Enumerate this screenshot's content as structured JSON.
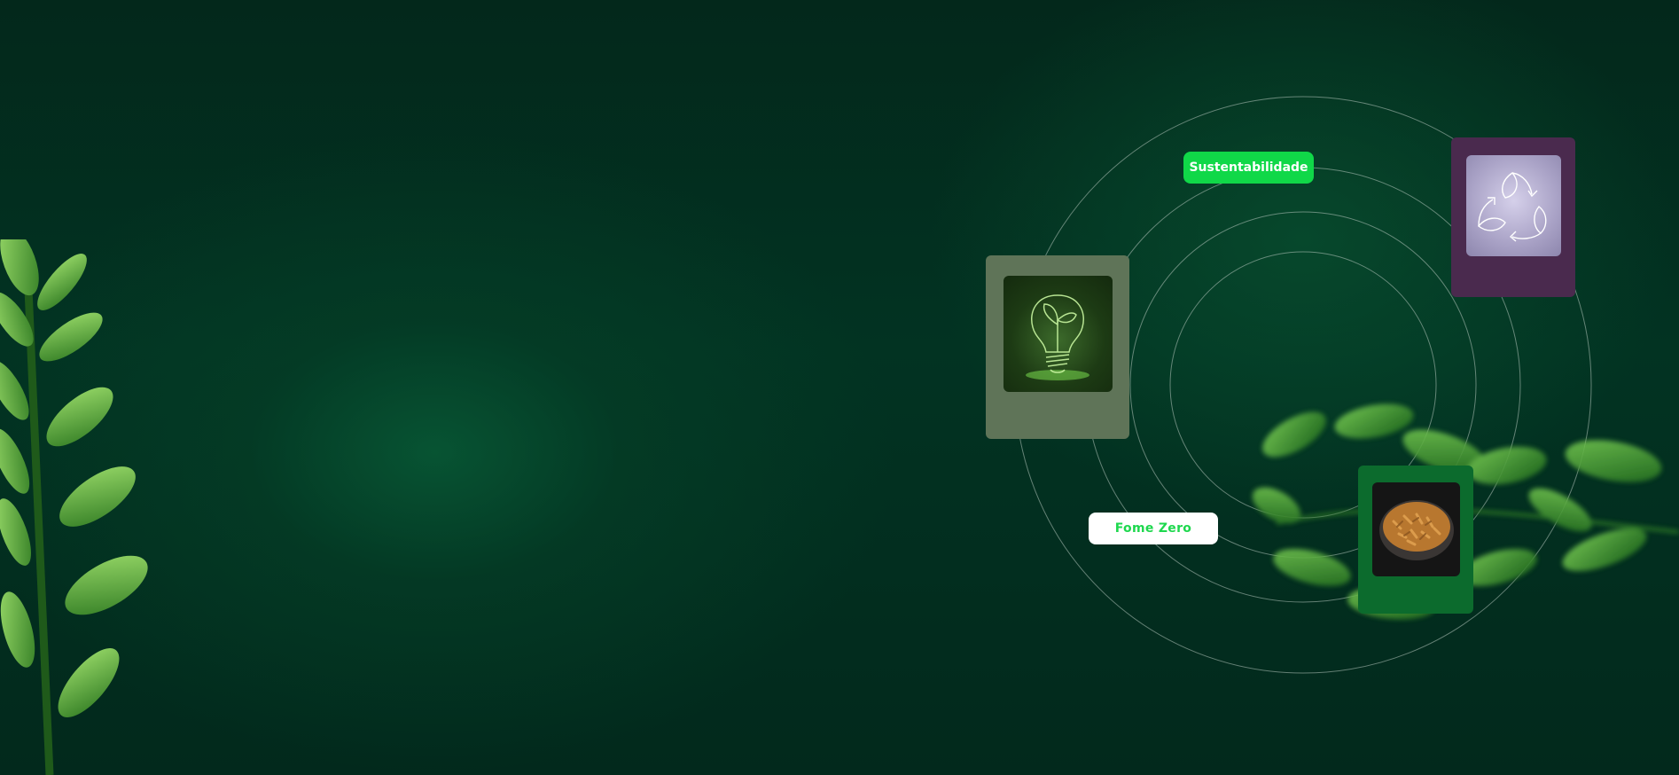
{
  "tags": {
    "sustentabilidade": "Sustentabilidade",
    "fome_zero": "Fome Zero"
  },
  "cards": [
    {
      "name": "lightbulb-card",
      "icon": "lightbulb-sprout-icon",
      "color": "#5f7458"
    },
    {
      "name": "recycle-card",
      "icon": "recycle-leaves-icon",
      "color": "#4a2a4e"
    },
    {
      "name": "food-card",
      "icon": "pasta-bowl-image",
      "color": "#0c6b2d"
    }
  ],
  "colors": {
    "background": "#02271a",
    "accent_green": "#10d848",
    "ring_stroke": "#b7c6be"
  }
}
